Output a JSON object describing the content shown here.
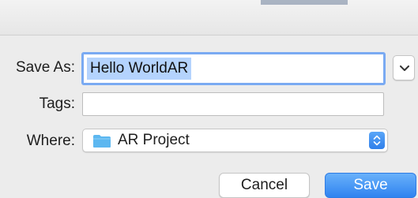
{
  "dialog": {
    "save_as_label": "Save As:",
    "save_as_value": "Hello WorldAR",
    "tags_label": "Tags:",
    "tags_value": "",
    "where_label": "Where:",
    "where_value": "AR Project",
    "cancel_label": "Cancel",
    "save_label": "Save"
  },
  "icons": {
    "expand": "chevron-down-icon",
    "folder": "folder-icon",
    "stepper": "up-down-stepper-icon"
  },
  "colors": {
    "accent": "#3a8df4",
    "selection": "#b4d3fd",
    "focus_ring": "#7aaaf2",
    "folder": "#5cb7f0"
  }
}
